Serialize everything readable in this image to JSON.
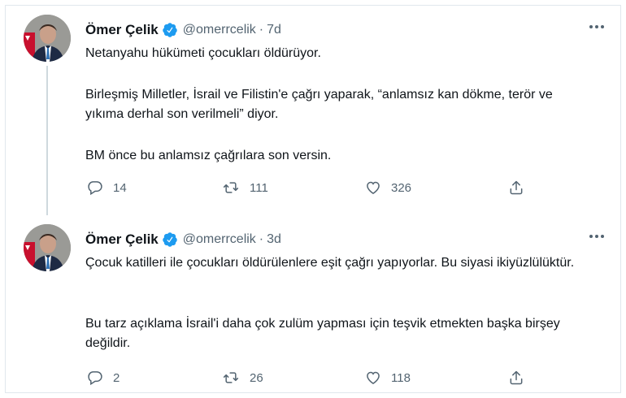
{
  "tweets": [
    {
      "author": {
        "name": "Ömer Çelik",
        "handle": "@omerrcelik",
        "verified": true
      },
      "time": "7d",
      "paragraphs": [
        "Netanyahu hükümeti çocukları öldürüyor.",
        "Birleşmiş Milletler, İsrail ve Filistin'e çağrı yaparak, “anlamsız kan dökme, terör ve yıkıma derhal son verilmeli” diyor.",
        "BM önce bu anlamsız çağrılara son versin."
      ],
      "stats": {
        "replies": "14",
        "retweets": "111",
        "likes": "326"
      }
    },
    {
      "author": {
        "name": "Ömer Çelik",
        "handle": "@omerrcelik",
        "verified": true
      },
      "time": "3d",
      "paragraphs": [
        "Çocuk katilleri ile çocukları öldürülenlere eşit çağrı yapıyorlar. Bu siyasi ikiyüzlülüktür.",
        "Bu tarz açıklama İsrail'i daha çok zulüm yapması için teşvik etmekten başka birşey değildir."
      ],
      "stats": {
        "replies": "2",
        "retweets": "26",
        "likes": "118"
      }
    }
  ],
  "separator": "·",
  "icons": {
    "reply": "reply-icon",
    "retweet": "retweet-icon",
    "like": "heart-icon",
    "share": "share-icon",
    "more": "more-icon",
    "verified": "verified-badge-icon"
  },
  "colors": {
    "verified": "#1d9bf0",
    "text": "#0f1419",
    "secondary": "#536471",
    "thread_line": "#cfd9de"
  }
}
